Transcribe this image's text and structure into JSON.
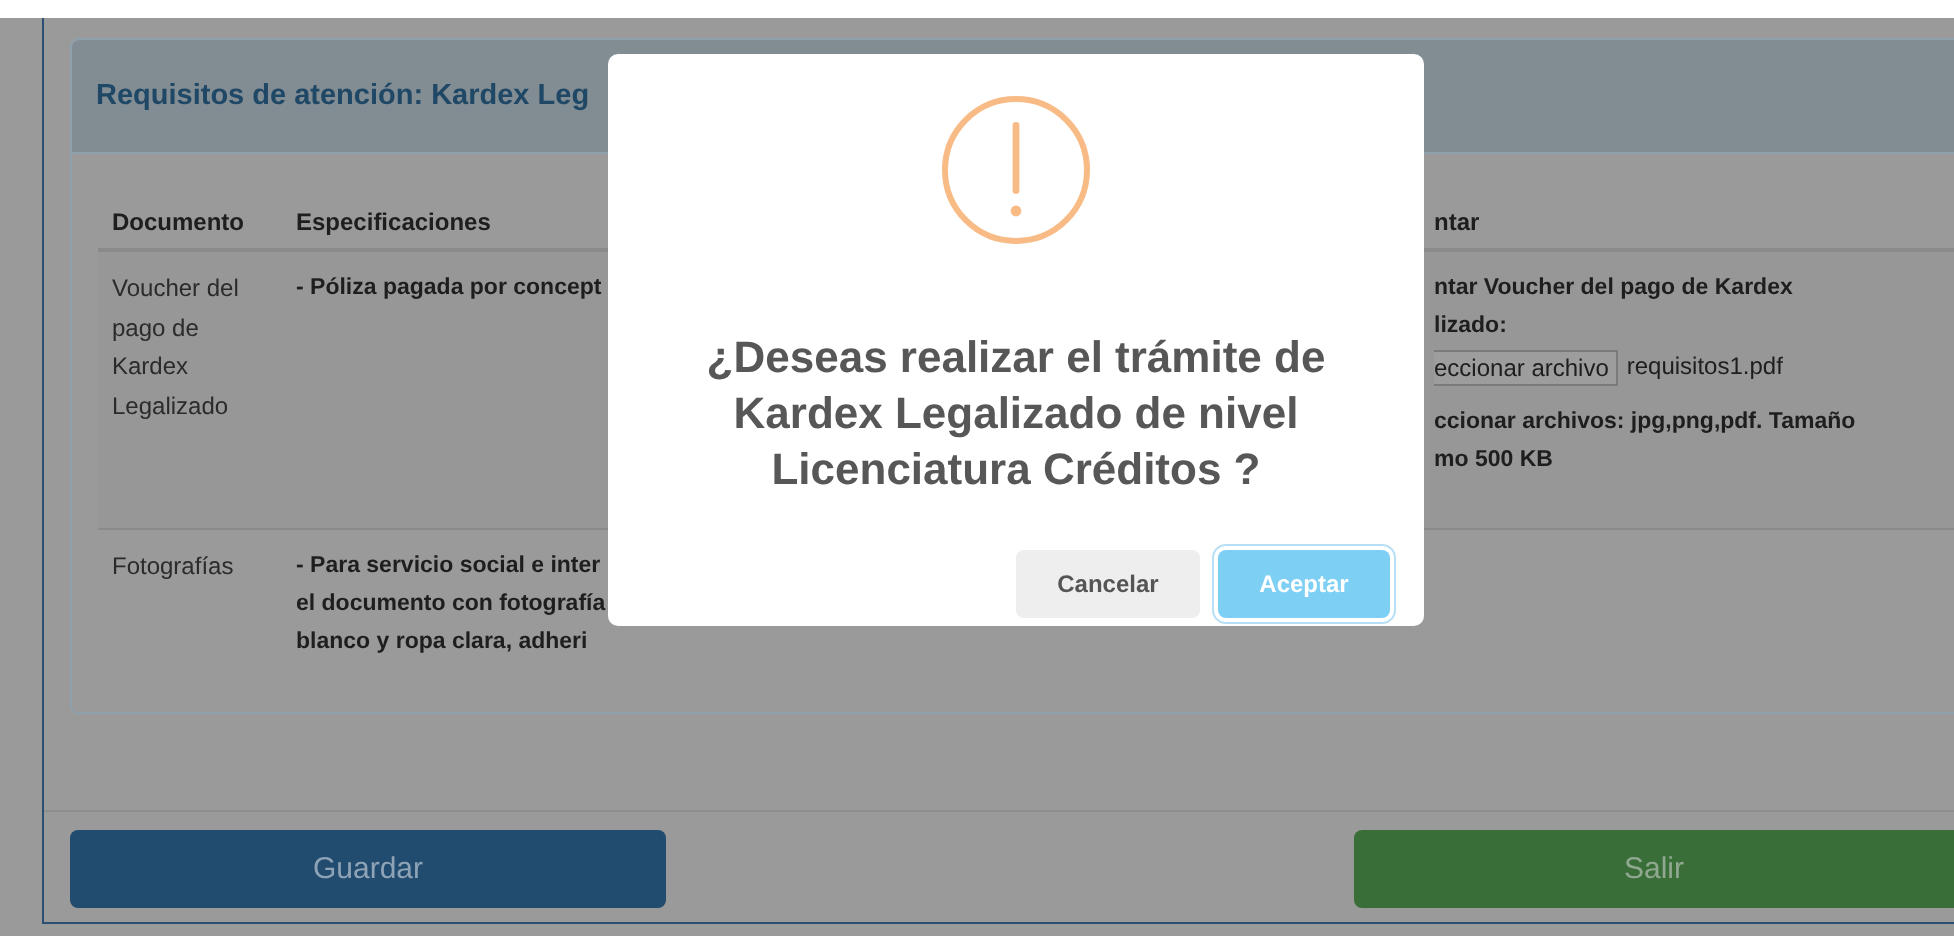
{
  "panel": {
    "title": "Requisitos de atención: Kardex Leg"
  },
  "table": {
    "columns": [
      "Documento",
      "Especificaciones",
      "ntar"
    ],
    "rows": [
      {
        "document": "Voucher del pago de Kardex Legalizado",
        "spec_lines": [
          "- Póliza pagada por concept"
        ],
        "upload": {
          "label_lines": [
            "ntar Voucher del pago de Kardex",
            "lizado:"
          ],
          "file_button": "eccionar archivo",
          "file_name": "requisitos1.pdf",
          "note_lines": [
            "ccionar archivos: jpg,png,pdf. Tamaño",
            "mo 500 KB"
          ]
        }
      },
      {
        "document": "Fotografías",
        "spec_lines": [
          "- Para servicio social e inter",
          "el documento con fotografía",
          "blanco y ropa clara, adheri"
        ]
      }
    ]
  },
  "footer": {
    "buttons": [
      {
        "label": "Guardar",
        "kind": "primary"
      },
      {
        "label": "Salir",
        "kind": "success"
      }
    ]
  },
  "dialog": {
    "title_lines": [
      "¿Deseas realizar el trámite de",
      "Kardex Legalizado de nivel",
      "Licenciatura Créditos ?"
    ],
    "buttons": [
      {
        "label": "Cancelar",
        "kind": "cancel",
        "selected": false
      },
      {
        "label": "Aceptar",
        "kind": "confirm",
        "selected": true
      }
    ]
  }
}
